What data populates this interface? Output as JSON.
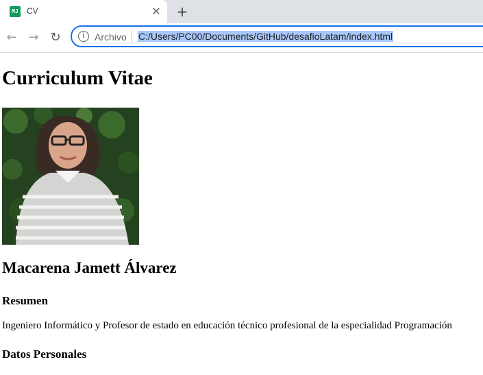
{
  "browser": {
    "tab": {
      "favicon_text": "MJ",
      "title": "CV",
      "close_glyph": "✕"
    },
    "new_tab_glyph": "+",
    "toolbar": {
      "back_glyph": "←",
      "forward_glyph": "→",
      "reload_glyph": "↻",
      "info_glyph": "i",
      "scheme_label": "Archivo",
      "url": "C:/Users/PC00/Documents/GitHub/desafioLatam/index.html"
    },
    "colors": {
      "accent": "#1a73e8",
      "selection": "#a8c7fa",
      "tabbar": "#dee1e6"
    }
  },
  "page": {
    "title": "Curriculum Vitae",
    "name": "Macarena Jamett Álvarez",
    "resumen_heading": "Resumen",
    "resumen_text": "Ingeniero Informático y Profesor de estado en educación técnico profesional de la especialidad Programación",
    "datos_heading": "Datos Personales"
  }
}
